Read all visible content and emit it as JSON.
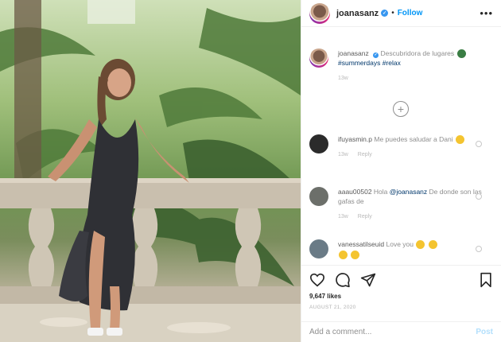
{
  "header": {
    "username": "joanasanz",
    "follow_label": "Follow",
    "dot": "•",
    "more_label": "•••",
    "avatar_icon": "profile-avatar",
    "verified_icon": "verified-badge-icon"
  },
  "caption": {
    "username": "joanasanz",
    "text": "Descubridora de lugares",
    "hashtags": "#summerdays #relax",
    "time": "13w"
  },
  "load_more_icon": "plus-circle-icon",
  "comments": [
    {
      "username": "ifuyasmin.p",
      "text": "Me puedes saludar a Dani",
      "time": "13w",
      "reply": "Reply",
      "avatar_color": "#2b2b2b"
    },
    {
      "username": "aaau00502",
      "text": "Hola",
      "mention": "@joanasanz",
      "text2": "De donde son las gafas de",
      "time": "13w",
      "reply": "Reply",
      "avatar_color": "#6c6f6a"
    },
    {
      "username": "vanessatilseuid",
      "text": "Love you",
      "avatar_color": "#6a7b86"
    }
  ],
  "actions": {
    "like_icon": "heart-icon",
    "comment_icon": "comment-icon",
    "share_icon": "paper-plane-icon",
    "save_icon": "bookmark-icon",
    "likes": "9,647 likes",
    "date": "AUGUST 21, 2020"
  },
  "add_comment": {
    "placeholder": "Add a comment...",
    "post_label": "Post"
  },
  "colors": {
    "accent": "#0095f6",
    "post_disabled": "#b2dffc",
    "border": "#efefef"
  }
}
